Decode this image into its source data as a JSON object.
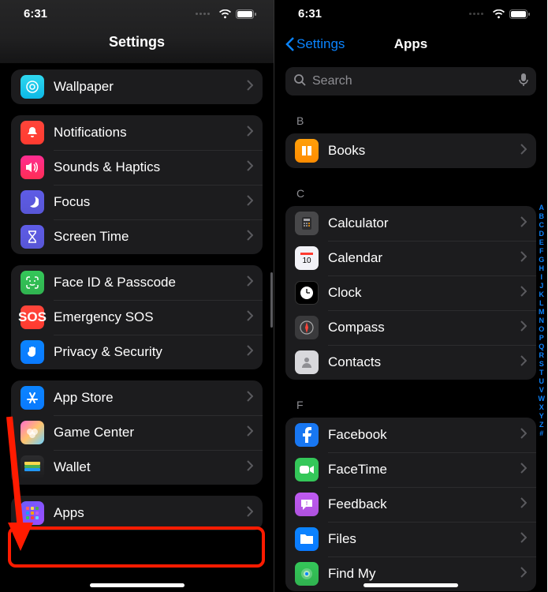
{
  "status": {
    "time": "6:31"
  },
  "left": {
    "title": "Settings",
    "groupA": [
      {
        "label": "Wallpaper",
        "icon": "wallpaper",
        "bg": "bg-cyan"
      }
    ],
    "groupB": [
      {
        "label": "Notifications",
        "icon": "bell",
        "bg": "bg-red"
      },
      {
        "label": "Sounds & Haptics",
        "icon": "speaker",
        "bg": "bg-pink"
      },
      {
        "label": "Focus",
        "icon": "moon",
        "bg": "bg-indigo"
      },
      {
        "label": "Screen Time",
        "icon": "hourglass",
        "bg": "bg-indigo"
      }
    ],
    "groupC": [
      {
        "label": "Face ID & Passcode",
        "icon": "faceid",
        "bg": "bg-green"
      },
      {
        "label": "Emergency SOS",
        "icon": "sos",
        "bg": "bg-redsos"
      },
      {
        "label": "Privacy & Security",
        "icon": "hand",
        "bg": "bg-blue"
      }
    ],
    "groupD": [
      {
        "label": "App Store",
        "icon": "appstore",
        "bg": "bg-blue"
      },
      {
        "label": "Game Center",
        "icon": "gamecenter",
        "bg": "bg-grad"
      },
      {
        "label": "Wallet",
        "icon": "wallet",
        "bg": "bg-wallet"
      }
    ],
    "groupE": [
      {
        "label": "Apps",
        "icon": "apps",
        "bg": "bg-apps"
      }
    ]
  },
  "right": {
    "back": "Settings",
    "title": "Apps",
    "search_placeholder": "Search",
    "sections": {
      "B": [
        {
          "label": "Books",
          "bg": "bg-orange"
        }
      ],
      "C": [
        {
          "label": "Calculator",
          "bg": "bg-gray"
        },
        {
          "label": "Calendar",
          "bg": "bg-white"
        },
        {
          "label": "Clock",
          "bg": "bg-black"
        },
        {
          "label": "Compass",
          "bg": "bg-dgray"
        },
        {
          "label": "Contacts",
          "bg": "bg-gray"
        }
      ],
      "F": [
        {
          "label": "Facebook",
          "bg": "bg-fb"
        },
        {
          "label": "FaceTime",
          "bg": "bg-ft"
        },
        {
          "label": "Feedback",
          "bg": "bg-purple"
        },
        {
          "label": "Files",
          "bg": "bg-blue"
        },
        {
          "label": "Find My",
          "bg": "bg-green"
        }
      ]
    },
    "index": [
      "A",
      "B",
      "C",
      "D",
      "E",
      "F",
      "G",
      "H",
      "I",
      "J",
      "K",
      "L",
      "M",
      "N",
      "O",
      "P",
      "Q",
      "R",
      "S",
      "T",
      "U",
      "V",
      "W",
      "X",
      "Y",
      "Z",
      "#"
    ],
    "section_headers": {
      "B": "B",
      "C": "C",
      "F": "F"
    }
  }
}
